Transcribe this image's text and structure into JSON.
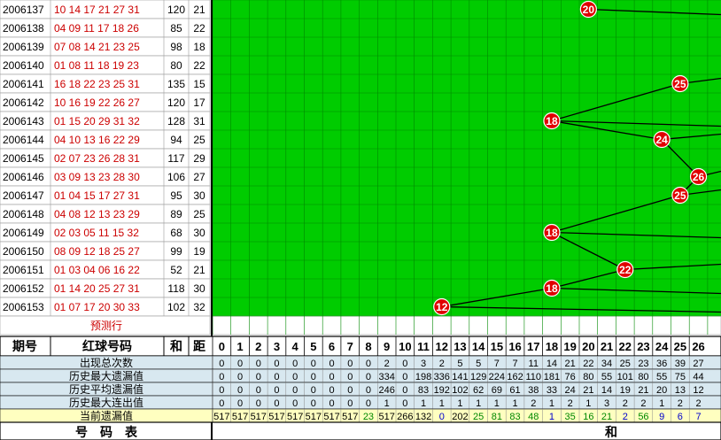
{
  "table": {
    "rows": [
      {
        "issue": "2006137",
        "numbers": "10 14 17 21 27 31",
        "sum": "120",
        "dist": "21"
      },
      {
        "issue": "2006138",
        "numbers": "04 09 11 17 18 26",
        "sum": "85",
        "dist": "22"
      },
      {
        "issue": "2006139",
        "numbers": "07 08 14 21 23 25",
        "sum": "98",
        "dist": "18"
      },
      {
        "issue": "2006140",
        "numbers": "01 08 11 18 19 23",
        "sum": "80",
        "dist": "22"
      },
      {
        "issue": "2006141",
        "numbers": "16 18 22 23 25 31",
        "sum": "135",
        "dist": "15"
      },
      {
        "issue": "2006142",
        "numbers": "10 16 19 22 26 27",
        "sum": "120",
        "dist": "17"
      },
      {
        "issue": "2006143",
        "numbers": "01 15 20 29 31 32",
        "sum": "128",
        "dist": "31"
      },
      {
        "issue": "2006144",
        "numbers": "04 10 13 16 22 29",
        "sum": "94",
        "dist": "25"
      },
      {
        "issue": "2006145",
        "numbers": "02 07 23 26 28 31",
        "sum": "117",
        "dist": "29"
      },
      {
        "issue": "2006146",
        "numbers": "03 09 13 23 28 30",
        "sum": "106",
        "dist": "27"
      },
      {
        "issue": "2006147",
        "numbers": "01 04 15 17 27 31",
        "sum": "95",
        "dist": "30"
      },
      {
        "issue": "2006148",
        "numbers": "04 08 12 13 23 29",
        "sum": "89",
        "dist": "25"
      },
      {
        "issue": "2006149",
        "numbers": "02 03 05 11 15 32",
        "sum": "68",
        "dist": "30"
      },
      {
        "issue": "2006150",
        "numbers": "08 09 12 18 25 27",
        "sum": "99",
        "dist": "19"
      },
      {
        "issue": "2006151",
        "numbers": "01 03 04 06 16 22",
        "sum": "52",
        "dist": "21"
      },
      {
        "issue": "2006152",
        "numbers": "01 14 20 25 27 31",
        "sum": "118",
        "dist": "30"
      },
      {
        "issue": "2006153",
        "numbers": "01 07 17 20 30 33",
        "sum": "102",
        "dist": "32"
      }
    ],
    "predict_label": "预测行"
  },
  "header": {
    "issue": "期号",
    "numbers": "红球号码",
    "sum": "和",
    "dist": "距",
    "columns": [
      "0",
      "1",
      "2",
      "3",
      "4",
      "5",
      "6",
      "7",
      "8",
      "9",
      "10",
      "11",
      "12",
      "13",
      "14",
      "15",
      "16",
      "17",
      "18",
      "19",
      "20",
      "21",
      "22",
      "23",
      "24",
      "25",
      "26"
    ]
  },
  "stats": {
    "labels": [
      "出现总次数",
      "历史最大遗漏值",
      "历史平均遗漏值",
      "历史最大连出值",
      "当前遗漏值"
    ],
    "rows": [
      [
        "0",
        "0",
        "0",
        "0",
        "0",
        "0",
        "0",
        "0",
        "0",
        "2",
        "0",
        "3",
        "2",
        "5",
        "5",
        "7",
        "7",
        "11",
        "14",
        "21",
        "22",
        "34",
        "25",
        "23",
        "36",
        "39",
        "27"
      ],
      [
        "0",
        "0",
        "0",
        "0",
        "0",
        "0",
        "0",
        "0",
        "0",
        "334",
        "0",
        "198",
        "336",
        "141",
        "129",
        "224",
        "162",
        "110",
        "181",
        "76",
        "80",
        "55",
        "101",
        "80",
        "55",
        "75",
        "44"
      ],
      [
        "0",
        "0",
        "0",
        "0",
        "0",
        "0",
        "0",
        "0",
        "0",
        "246",
        "0",
        "83",
        "192",
        "102",
        "62",
        "69",
        "61",
        "38",
        "33",
        "24",
        "21",
        "14",
        "19",
        "21",
        "20",
        "13",
        "12"
      ],
      [
        "0",
        "0",
        "0",
        "0",
        "0",
        "0",
        "0",
        "0",
        "0",
        "1",
        "0",
        "1",
        "1",
        "1",
        "1",
        "1",
        "1",
        "2",
        "1",
        "2",
        "1",
        "3",
        "2",
        "2",
        "1",
        "2",
        "2"
      ],
      [
        "517",
        "517",
        "517",
        "517",
        "517",
        "517",
        "517",
        "517",
        "23",
        "517",
        "266",
        "132",
        "0",
        "202",
        "25",
        "81",
        "83",
        "48",
        "1",
        "35",
        "16",
        "21",
        "2",
        "56",
        "9",
        "6",
        "7"
      ]
    ]
  },
  "footer": {
    "left": "号　码　表",
    "right": "和"
  },
  "chart_data": {
    "type": "line",
    "x": [
      "2006137",
      "2006138",
      "2006139",
      "2006140",
      "2006141",
      "2006142",
      "2006143",
      "2006144",
      "2006145",
      "2006146",
      "2006147",
      "2006148",
      "2006149",
      "2006150",
      "2006151",
      "2006152",
      "2006153"
    ],
    "marked_values": [
      {
        "issue": "2006137",
        "value": 20
      },
      {
        "issue": "2006141",
        "value": 25
      },
      {
        "issue": "2006143",
        "value": 18
      },
      {
        "issue": "2006144",
        "value": 24
      },
      {
        "issue": "2006146",
        "value": 26
      },
      {
        "issue": "2006147",
        "value": 25
      },
      {
        "issue": "2006149",
        "value": 18
      },
      {
        "issue": "2006151",
        "value": 22
      },
      {
        "issue": "2006152",
        "value": 18
      },
      {
        "issue": "2006153",
        "value": 12
      }
    ],
    "colors": {
      "grid_bg": "#00cc00",
      "grid_line": "#008800",
      "ball": "#e00000",
      "stat_bg": "#d8e8f0",
      "highlight_bg": "#ffffc0"
    }
  }
}
